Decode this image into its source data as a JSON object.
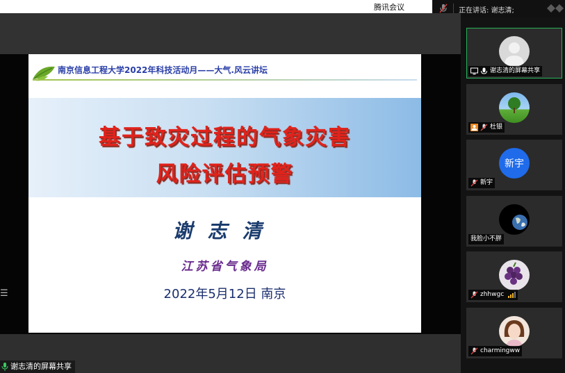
{
  "window": {
    "app_title": "腾讯会议"
  },
  "topbar": {
    "speaking_label": "正在讲话: 谢志清;"
  },
  "slide": {
    "header": "南京信息工程大学2022年科技活动月——大气.风云讲坛",
    "title_line1": "基于致灾过程的气象灾害",
    "title_line2": "风险评估预警",
    "author": "谢志清",
    "organization": "江苏省气象局",
    "date_place": "2022年5月12日  南京"
  },
  "sharer_label": "谢志清的屏幕共享",
  "participants": [
    {
      "name": "谢志清的屏幕共享",
      "avatar_kind": "default-avatar",
      "active": true
    },
    {
      "name": "杜银",
      "avatar_kind": "landscape-avatar",
      "active": false
    },
    {
      "name": "新宇",
      "avatar_kind": "text-avatar",
      "avatar_text": "新宇",
      "avatar_color": "#1f6bea",
      "active": false
    },
    {
      "name": "我脸小不胖",
      "avatar_kind": "earth-avatar",
      "active": false
    },
    {
      "name": "zhhwgc",
      "avatar_kind": "grape-avatar",
      "active": false,
      "signal_level": 3
    },
    {
      "name": "charmingww",
      "avatar_kind": "portrait-avatar",
      "active": false
    }
  ],
  "colors": {
    "active_border": "#27b35a",
    "title_red": "#e0231c",
    "header_blue": "#2a3fa8"
  }
}
